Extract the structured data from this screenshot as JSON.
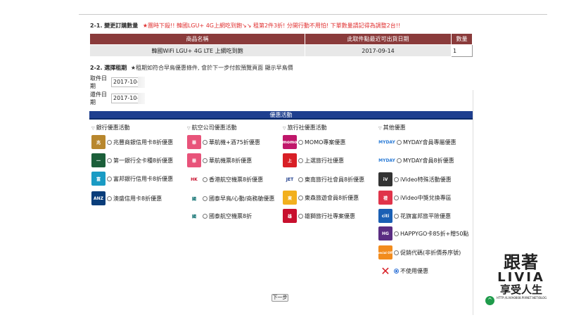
{
  "section1": {
    "heading": "2-1. 變更訂購數量",
    "note": "★團時下殺!! 韓國LGU+ 4G上網吃到飽↘↘ 租第2件3折! 分開行動不用怕! 下單數量請記得為調整2台!!"
  },
  "order_table": {
    "headers": [
      "商品名稱",
      "此取件點最近可出貨日期",
      "數量"
    ],
    "row": {
      "name": "韓國WiFi LGU+ 4G LTE 上網吃到飽",
      "date": "2017-09-14",
      "qty": "1"
    }
  },
  "section2": {
    "heading": "2-2. 選擇租期",
    "sub": "★租期如符合早鳥優惠條件, 會於下一步付款預覽頁面 顯示早鳥價"
  },
  "dates": {
    "pickup_label": "取件日期",
    "pickup_value": "2017-10-",
    "return_label": "還件日期",
    "return_value": "2017-10-"
  },
  "promo": {
    "header": "優惠活動",
    "columns": [
      {
        "title": "銀行優惠活動",
        "items": [
          "兆豐商銀信用卡8折優惠",
          "第一銀行全卡種8折優惠",
          "富邦銀行信用卡8折優惠",
          "澳盛信用卡8折優惠"
        ]
      },
      {
        "title": "航空公司優惠活動",
        "items": [
          "華航機+酒75折優惠",
          "華航機票8折優惠",
          "香港航空機票8折優惠",
          "國泰早鳥/心動/商務艙優惠",
          "國泰航空機票8折"
        ]
      },
      {
        "title": "旅行社優惠活動",
        "items": [
          "MOMO專案優惠",
          "上選旅行社優惠",
          "東南旅行社會員8折優惠",
          "東森旅遊會員8折優惠",
          "雄獅旅行社專案優惠"
        ]
      },
      {
        "title": "其他優惠",
        "items": [
          "MYDAY會員專屬優惠",
          "MYDAY會員8折優惠",
          "iVideo特殊活動優惠",
          "iVideo中獎兌換專區",
          "花旗富邦旅平險優惠",
          "HAPPYGO卡85折+贈50點",
          "促銷代碼(非折價券序號)",
          "不使用優惠"
        ]
      }
    ],
    "logos": {
      "bank": [
        "兆",
        "一",
        "富",
        "ANZ"
      ],
      "air": [
        "華",
        "華",
        "HK",
        "國",
        "國"
      ],
      "travel": [
        "momo",
        "上",
        "JET",
        "東",
        "雄"
      ],
      "other": [
        "MYDAY",
        "MYDAY",
        "iV",
        "禮",
        "citi",
        "HG",
        "Special Offer",
        "✕"
      ]
    }
  },
  "next_button": "下一步",
  "watermark": {
    "line1": "跟著",
    "line2": "LIVIA",
    "line3": "享受人生",
    "url": "HTTP://LIVIA0808.PIXNET.NET/BLOG"
  },
  "colors": {
    "table_header": "#8a3b3b",
    "promo_header": "#1e3f8f",
    "note": "#e03030"
  }
}
